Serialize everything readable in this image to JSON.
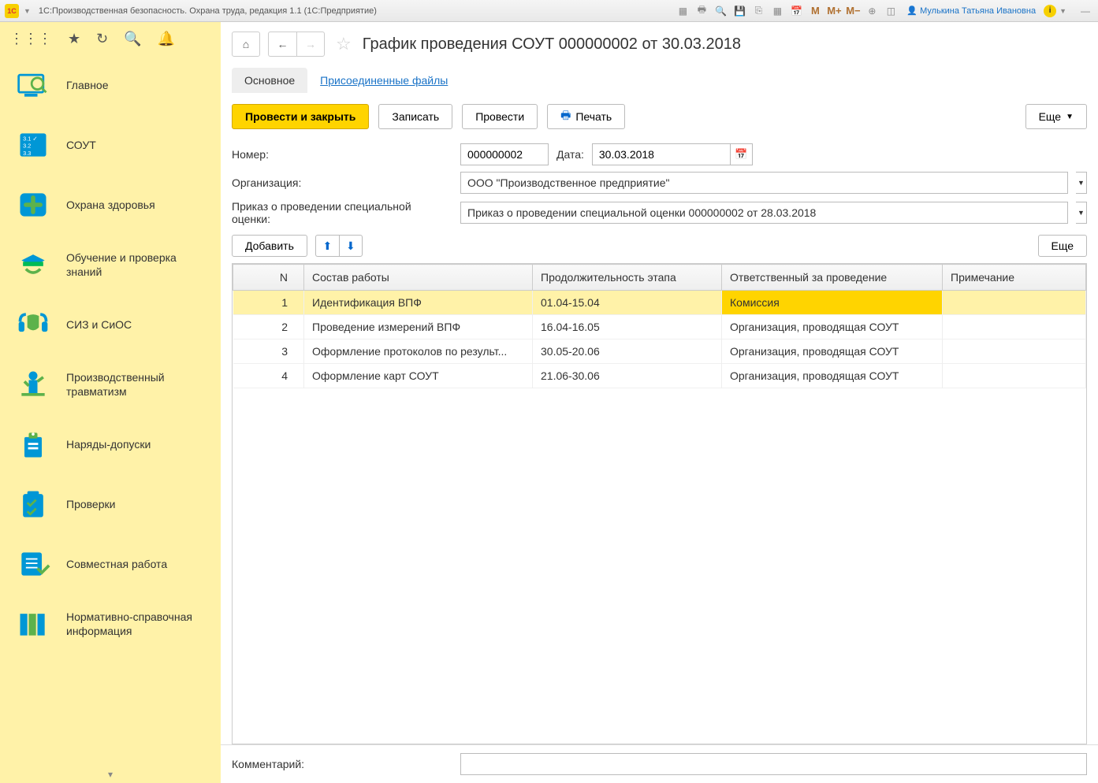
{
  "titlebar": {
    "title": "1С:Производственная безопасность. Охрана труда, редакция 1.1  (1С:Предприятие)",
    "user": "Мулькина Татьяна Ивановна",
    "m_buttons": [
      "M",
      "M+",
      "M−"
    ]
  },
  "sidebar": {
    "items": [
      {
        "label": "Главное"
      },
      {
        "label": "СОУТ"
      },
      {
        "label": "Охрана здоровья"
      },
      {
        "label": "Обучение и проверка знаний"
      },
      {
        "label": "СИЗ и СиОС"
      },
      {
        "label": "Производственный травматизм"
      },
      {
        "label": "Наряды-допуски"
      },
      {
        "label": "Проверки"
      },
      {
        "label": "Совместная работа"
      },
      {
        "label": "Нормативно-справочная информация"
      }
    ]
  },
  "page": {
    "title": "График проведения СОУТ 000000002 от 30.03.2018",
    "tabs": {
      "main": "Основное",
      "files": "Присоединенные файлы"
    },
    "buttons": {
      "post_close": "Провести и закрыть",
      "save": "Записать",
      "post": "Провести",
      "print": "Печать",
      "more": "Еще",
      "add": "Добавить",
      "more2": "Еще"
    },
    "fields": {
      "number_label": "Номер:",
      "number_value": "000000002",
      "date_label": "Дата:",
      "date_value": "30.03.2018",
      "org_label": "Организация:",
      "org_value": "ООО \"Производственное предприятие\"",
      "order_label": "Приказ о проведении специальной оценки:",
      "order_value": "Приказ о проведении специальной оценки 000000002 от 28.03.2018",
      "comment_label": "Комментарий:"
    },
    "table": {
      "headers": {
        "n": "N",
        "work": "Состав работы",
        "duration": "Продолжительность этапа",
        "responsible": "Ответственный за проведение",
        "note": "Примечание"
      },
      "rows": [
        {
          "n": "1",
          "work": "Идентификация ВПФ",
          "duration": "01.04-15.04",
          "responsible": "Комиссия",
          "selected": true
        },
        {
          "n": "2",
          "work": "Проведение измерений ВПФ",
          "duration": "16.04-16.05",
          "responsible": "Организация, проводящая СОУТ"
        },
        {
          "n": "3",
          "work": "Оформление протоколов по результ...",
          "duration": "30.05-20.06",
          "responsible": "Организация, проводящая СОУТ"
        },
        {
          "n": "4",
          "work": "Оформление карт СОУТ",
          "duration": "21.06-30.06",
          "responsible": "Организация, проводящая СОУТ"
        }
      ]
    }
  }
}
